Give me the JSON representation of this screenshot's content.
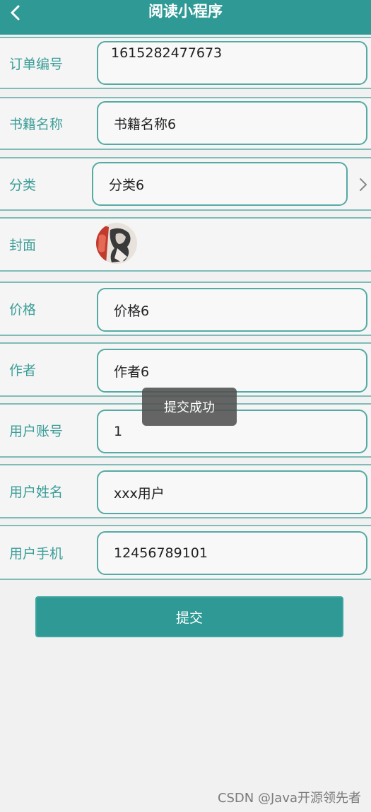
{
  "header": {
    "title": "阅读小程序",
    "background": "#2f9a95"
  },
  "form": {
    "order_no": {
      "label": "订单编号",
      "value": "1615282477673"
    },
    "book_name": {
      "label": "书籍名称",
      "value": "书籍名称6"
    },
    "category": {
      "label": "分类",
      "value": "分类6"
    },
    "cover": {
      "label": "封面"
    },
    "price": {
      "label": "价格",
      "value": "价格6"
    },
    "author": {
      "label": "作者",
      "value": "作者6"
    },
    "user_account": {
      "label": "用户账号",
      "value": "1"
    },
    "user_name": {
      "label": "用户姓名",
      "value": "xxx用户"
    },
    "user_phone": {
      "label": "用户手机",
      "value": "12456789101"
    }
  },
  "submit": {
    "label": "提交"
  },
  "toast": {
    "text": "提交成功"
  },
  "watermark": "CSDN @Java开源领先者",
  "accent_color": "#2f9a95"
}
